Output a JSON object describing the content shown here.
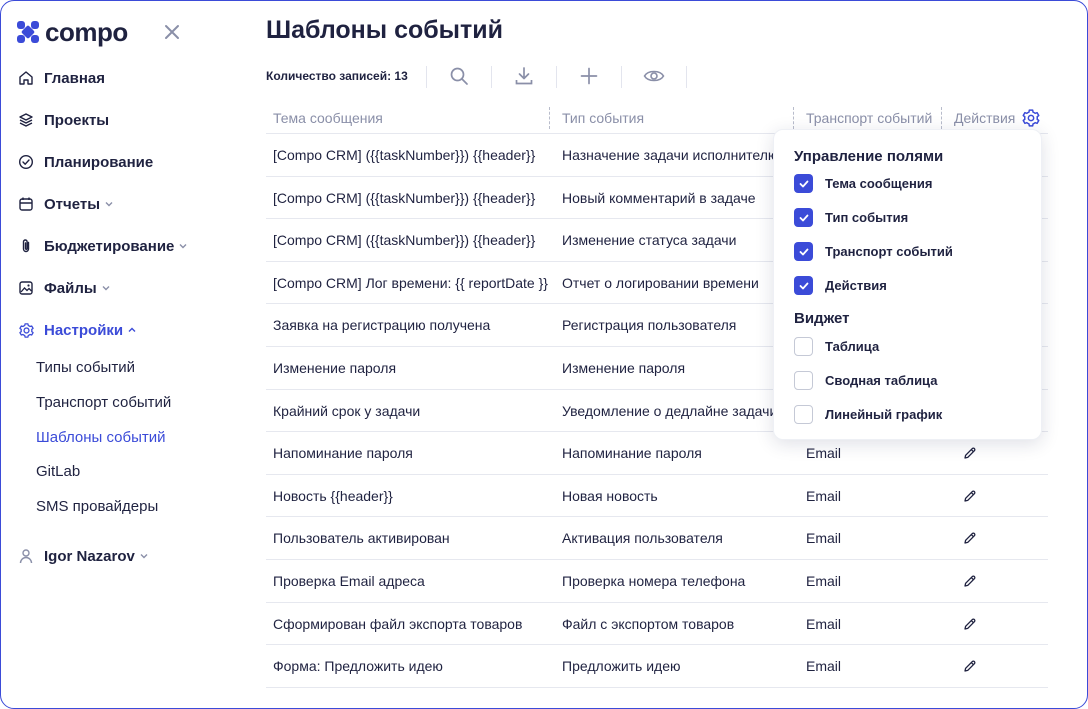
{
  "brand": {
    "name": "compo"
  },
  "colors": {
    "accent": "#3b4bd8",
    "text": "#1f2240",
    "muted": "#8a8fa8"
  },
  "sidebar": {
    "items": [
      {
        "label": "Главная",
        "icon": "home-icon"
      },
      {
        "label": "Проекты",
        "icon": "layers-icon"
      },
      {
        "label": "Планирование",
        "icon": "check-circle-icon"
      },
      {
        "label": "Отчеты",
        "icon": "calendar-icon"
      },
      {
        "label": "Бюджетирование",
        "icon": "paperclip-icon"
      },
      {
        "label": "Файлы",
        "icon": "image-icon"
      },
      {
        "label": "Настройки",
        "icon": "gear-icon"
      }
    ],
    "settings_sub": [
      "Типы событий",
      "Транспорт событий",
      "Шаблоны событий",
      "GitLab",
      "SMS провайдеры"
    ],
    "user": "Igor Nazarov"
  },
  "page": {
    "title": "Шаблоны событий",
    "records_count": "Количество записей: 13"
  },
  "table": {
    "headers": [
      "Тема сообщения",
      "Тип события",
      "Транспорт событий",
      "Действия"
    ],
    "rows": [
      [
        "[Compo CRM] ({{taskNumber}}) {{header}}",
        "Назначение задачи исполнителю",
        ""
      ],
      [
        "[Compo CRM] ({{taskNumber}}) {{header}}",
        "Новый комментарий в задаче",
        ""
      ],
      [
        "[Compo CRM] ({{taskNumber}}) {{header}}",
        "Изменение статуса задачи",
        ""
      ],
      [
        "[Compo CRM] Лог времени: {{ reportDate }}",
        "Отчет о логировании времени",
        ""
      ],
      [
        "Заявка на регистрацию получена",
        "Регистрация пользователя",
        ""
      ],
      [
        "Изменение пароля",
        "Изменение пароля",
        ""
      ],
      [
        "Крайний срок у задачи",
        "Уведомление о дедлайне задачи",
        ""
      ],
      [
        "Напоминание пароля",
        "Напоминание пароля",
        "Email"
      ],
      [
        "Новость {{header}}",
        "Новая новость",
        "Email"
      ],
      [
        "Пользователь активирован",
        "Активация пользователя",
        "Email"
      ],
      [
        "Проверка Email адреса",
        "Проверка номера телефона",
        "Email"
      ],
      [
        "Сформирован файл экспорта товаров",
        "Файл с экспортом товаров",
        "Email"
      ],
      [
        "Форма: Предложить идею",
        "Предложить идею",
        "Email"
      ]
    ]
  },
  "popover": {
    "fields_title": "Управление полями",
    "fields": [
      {
        "label": "Тема сообщения",
        "checked": true
      },
      {
        "label": "Тип события",
        "checked": true
      },
      {
        "label": "Транспорт событий",
        "checked": true
      },
      {
        "label": "Действия",
        "checked": true
      }
    ],
    "widget_title": "Виджет",
    "widgets": [
      {
        "label": "Таблица",
        "checked": false
      },
      {
        "label": "Сводная таблица",
        "checked": false
      },
      {
        "label": "Линейный график",
        "checked": false
      }
    ]
  }
}
